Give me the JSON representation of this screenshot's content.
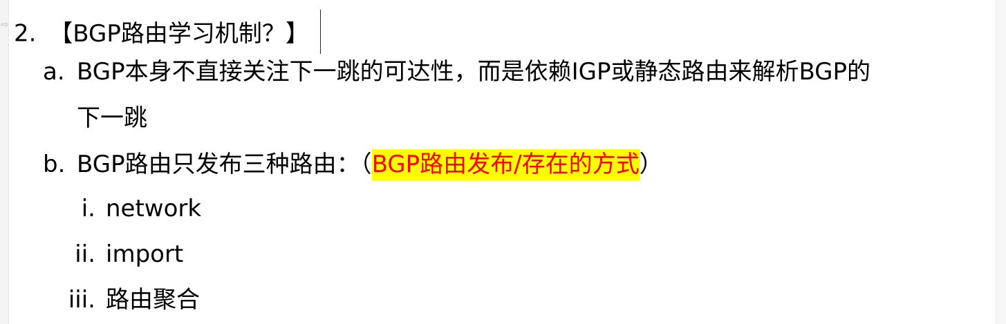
{
  "outline": {
    "item2": {
      "marker": "2.",
      "text": "【BGP路由学习机制？】"
    },
    "item_a": {
      "marker": "a.",
      "text_line1": "BGP本身不直接关注下一跳的可达性，而是依赖IGP或静态路由来解析BGP的",
      "text_line2": "下一跳"
    },
    "item_b": {
      "marker": "b.",
      "text_before": "BGP路由只发布三种路由：（",
      "highlight": "BGP路由发布/存在的方式",
      "text_after": "）",
      "highlight_bg_color": "#ffff00",
      "highlight_text_color": "#ff0000"
    },
    "sub_items": [
      {
        "marker": "i.",
        "text": "network"
      },
      {
        "marker": "ii.",
        "text": "import"
      },
      {
        "marker": "iii.",
        "text": "路由聚合"
      }
    ]
  }
}
